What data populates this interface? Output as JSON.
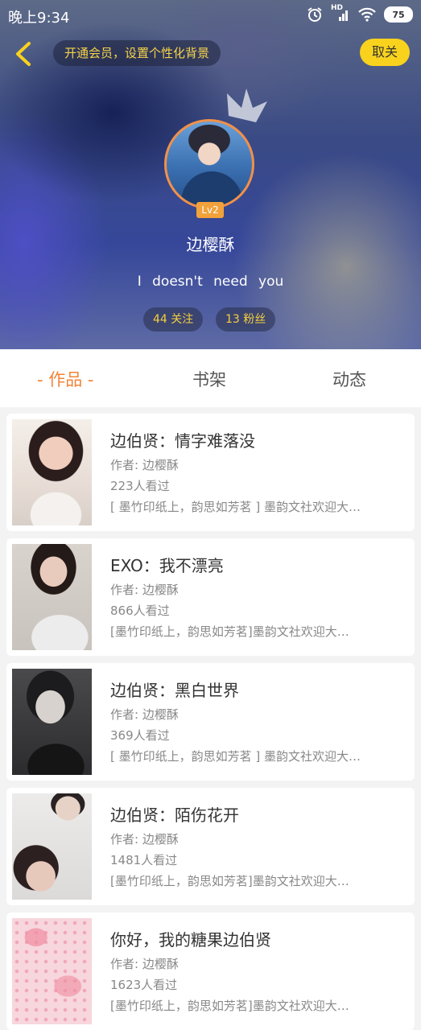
{
  "status_bar": {
    "time": "晚上9:34",
    "network": "HD",
    "battery": "75"
  },
  "header": {
    "vip_tip": "开通会员，设置个性化背景",
    "cancel_label": "取关",
    "level": "Lv2",
    "nickname": "边樱酥",
    "signature": "I  doesn't  need  you",
    "following": "44 关注",
    "followers": "13 粉丝"
  },
  "tabs": [
    {
      "label": "- 作品 -",
      "active": true
    },
    {
      "label": "书架",
      "active": false
    },
    {
      "label": "动态",
      "active": false
    }
  ],
  "works": [
    {
      "title": "边伯贤：情字难落没",
      "author": "作者: 边樱酥",
      "views": "223人看过",
      "desc": "[ 墨竹印纸上，韵思如芳茗 ] 墨韵文社欢迎大…"
    },
    {
      "title": "EXO：我不漂亮",
      "author": "作者: 边樱酥",
      "views": "866人看过",
      "desc": "[墨竹印纸上，韵思如芳茗]墨韵文社欢迎大…"
    },
    {
      "title": "边伯贤：黑白世界",
      "author": "作者: 边樱酥",
      "views": "369人看过",
      "desc": "[ 墨竹印纸上，韵思如芳茗 ] 墨韵文社欢迎大…"
    },
    {
      "title": "边伯贤：陌伤花开",
      "author": "作者: 边樱酥",
      "views": "1481人看过",
      "desc": "[墨竹印纸上，韵思如芳茗]墨韵文社欢迎大…"
    },
    {
      "title": "你好，我的糖果边伯贤",
      "author": "作者: 边樱酥",
      "views": "1623人看过",
      "desc": "[墨竹印纸上，韵思如芳茗]墨韵文社欢迎大…"
    }
  ],
  "colors": {
    "accent": "#f08437",
    "cancel_bg": "#f8d21d",
    "stat_text": "#f5cf3c"
  }
}
